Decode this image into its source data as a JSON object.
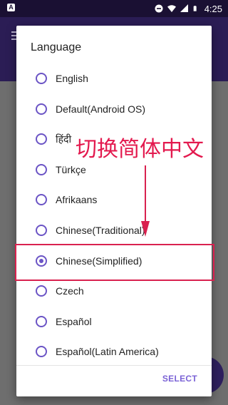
{
  "status_bar": {
    "time": "4:25",
    "left_icon": "A",
    "icons": [
      "dnd-icon",
      "wifi-icon",
      "signal-icon",
      "battery-icon"
    ]
  },
  "dialog": {
    "title": "Language",
    "options": [
      {
        "label": "English",
        "checked": false
      },
      {
        "label": "Default(Android OS)",
        "checked": false
      },
      {
        "label": "हिंदी",
        "checked": false
      },
      {
        "label": "Türkçe",
        "checked": false
      },
      {
        "label": "Afrikaans",
        "checked": false
      },
      {
        "label": "Chinese(Traditional)",
        "checked": false
      },
      {
        "label": "Chinese(Simplified)",
        "checked": true
      },
      {
        "label": "Czech",
        "checked": false
      },
      {
        "label": "Español",
        "checked": false
      },
      {
        "label": "Español(Latin America)",
        "checked": false
      }
    ],
    "select_label": "SELECT"
  },
  "annotation": {
    "text": "切换简体中文",
    "color": "#e3194e"
  },
  "colors": {
    "accent": "#6b54c5",
    "status_bar": "#1a1033",
    "app_bar": "#2b1d55"
  }
}
